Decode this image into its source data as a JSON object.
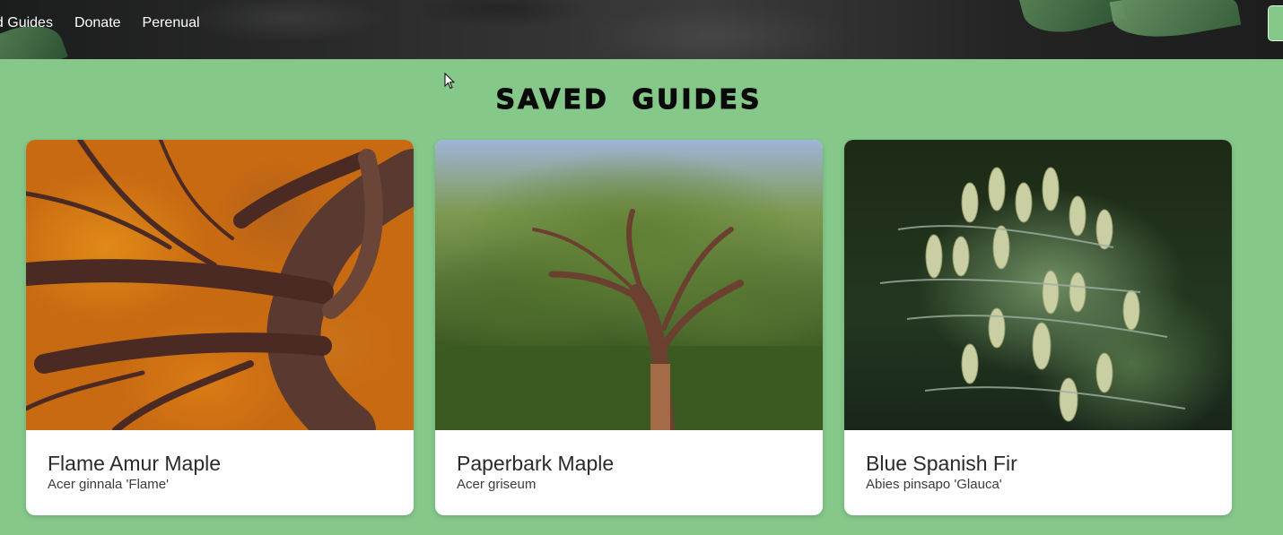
{
  "nav": {
    "items": [
      "ed Guides",
      "Donate",
      "Perenual"
    ]
  },
  "page": {
    "title": "SAVED GUIDES"
  },
  "cards": [
    {
      "name": "Flame Amur Maple",
      "scientific": "Acer ginnala 'Flame'"
    },
    {
      "name": "Paperbark Maple",
      "scientific": "Acer griseum"
    },
    {
      "name": "Blue Spanish Fir",
      "scientific": "Abies pinsapo 'Glauca'"
    }
  ],
  "colors": {
    "background": "#85c88a",
    "header": "#2b2c2b",
    "card": "#ffffff",
    "text": "#2a2a2e"
  }
}
